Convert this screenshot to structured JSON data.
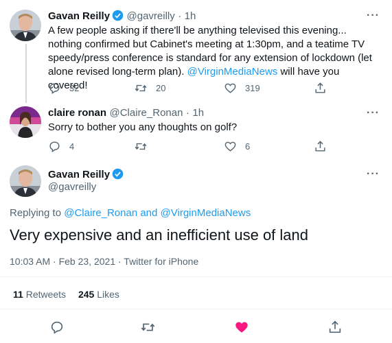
{
  "tweet1": {
    "name": "Gavan Reilly",
    "handle": "@gavreilly",
    "sep": "·",
    "time": "1h",
    "more": "···",
    "text_part1": "A few people asking if there'll be anything televised this evening... nothing confirmed but Cabinet's meeting at 1:30pm, and a teatime TV speedy/press conference is standard for any extension of lockdown (let alone revised long-term plan). ",
    "mention": "@VirginMediaNews",
    "text_part2": " will have you covered!",
    "replies": "32",
    "retweets": "20",
    "likes": "319"
  },
  "tweet2": {
    "name": "claire ronan",
    "handle": "@Claire_Ronan",
    "sep": "·",
    "time": "1h",
    "more": "···",
    "text": "Sorry to bother you any thoughts on golf?",
    "replies": "4",
    "retweets": "",
    "likes": "6"
  },
  "main": {
    "name": "Gavan Reilly",
    "handle": "@gavreilly",
    "more": "···",
    "replying_prefix": "Replying to ",
    "replying_user1": "@Claire_Ronan",
    "replying_and": " and ",
    "replying_user2": "@VirginMediaNews",
    "text": "Very expensive and an inefficient use of land",
    "timestamp": "10:03 AM · Feb 23, 2021 · ",
    "source": "Twitter for iPhone",
    "retweets_count": "11",
    "retweets_label": "Retweets",
    "likes_count": "245",
    "likes_label": "Likes"
  },
  "colors": {
    "accent": "#1d9bf0",
    "like": "#f91880",
    "muted": "#536471"
  },
  "icons": [
    "reply-icon",
    "retweet-icon",
    "like-icon",
    "share-icon",
    "verified-icon",
    "more-icon"
  ]
}
